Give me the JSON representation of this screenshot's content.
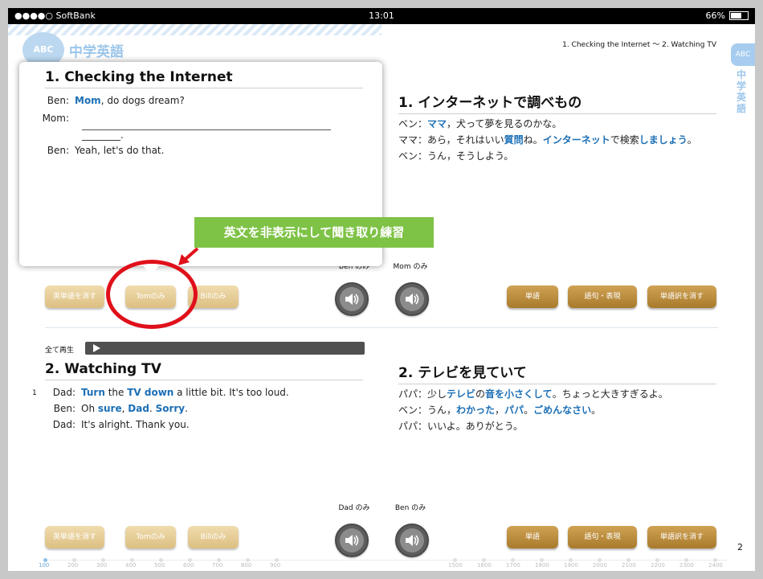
{
  "status_bar": {
    "carrier": "●●●●○ SoftBank",
    "time": "13:01",
    "battery": "66%"
  },
  "header": {
    "app_title": "中学英語",
    "logo_text": "ABC",
    "breadcrumb": "1. Checking the Internet ～ 2. Watching TV",
    "side_tab_text": "中学英語"
  },
  "section1": {
    "en_title": "1. Checking the Internet",
    "en_lines": [
      {
        "speaker": "Ben:",
        "parts": [
          {
            "t": "Mom",
            "h": true
          },
          {
            "t": ", do dogs dream?",
            "h": false
          }
        ]
      },
      {
        "speaker": "Mom:",
        "parts": []
      },
      {
        "speaker": "Ben:",
        "parts": [
          {
            "t": "Yeah, let's do that.",
            "h": false
          }
        ]
      }
    ],
    "blank_end": "________.",
    "jp_title": "1. インターネットで調べもの",
    "jp_lines": [
      [
        {
          "t": "ベン：",
          "h": false
        },
        {
          "t": "ママ",
          "h": true
        },
        {
          "t": "，犬って夢を見るのかな。",
          "h": false
        }
      ],
      [
        {
          "t": "ママ：あら，それはいい",
          "h": false
        },
        {
          "t": "質問",
          "h": true
        },
        {
          "t": "ね。",
          "h": false
        },
        {
          "t": "インターネット",
          "h": true
        },
        {
          "t": "で検索",
          "h": false
        },
        {
          "t": "しましょう",
          "h": true
        },
        {
          "t": "。",
          "h": false
        }
      ],
      [
        {
          "t": "ベン：うん，そうしよう。",
          "h": false
        }
      ]
    ],
    "buttons_left": [
      "英単語を消す",
      "Tomのみ",
      "Billのみ"
    ],
    "buttons_right": [
      "単語",
      "語句・表現",
      "単語訳を消す"
    ],
    "speakers": [
      "Ben のみ",
      "Mom のみ"
    ]
  },
  "popup_tip": "英文を非表示にして聞き取り練習",
  "play_all_label": "全て再生",
  "section2": {
    "row_number": "1",
    "en_title": "2. Watching TV",
    "en_lines": [
      {
        "speaker": "Dad:",
        "parts": [
          {
            "t": "Turn",
            "h": true
          },
          {
            "t": " the ",
            "h": false
          },
          {
            "t": "TV down",
            "h": true
          },
          {
            "t": " a little bit.  It's too loud.",
            "h": false
          }
        ]
      },
      {
        "speaker": "Ben:",
        "parts": [
          {
            "t": "Oh ",
            "h": false
          },
          {
            "t": "sure",
            "h": true
          },
          {
            "t": ", ",
            "h": false
          },
          {
            "t": "Dad",
            "h": true
          },
          {
            "t": ".  ",
            "h": false
          },
          {
            "t": "Sorry",
            "h": true
          },
          {
            "t": ".",
            "h": false
          }
        ]
      },
      {
        "speaker": "Dad:",
        "parts": [
          {
            "t": "It's alright.  Thank you.",
            "h": false
          }
        ]
      }
    ],
    "jp_title": "2. テレビを見ていて",
    "jp_lines": [
      [
        {
          "t": "パパ：少し",
          "h": false
        },
        {
          "t": "テレビ",
          "h": true
        },
        {
          "t": "の",
          "h": false
        },
        {
          "t": "音を小さくして",
          "h": true
        },
        {
          "t": "。ちょっと大きすぎるよ。",
          "h": false
        }
      ],
      [
        {
          "t": "ベン：うん，",
          "h": false
        },
        {
          "t": "わかった",
          "h": true
        },
        {
          "t": "，",
          "h": false
        },
        {
          "t": "パパ",
          "h": true
        },
        {
          "t": "。",
          "h": false
        },
        {
          "t": "ごめんなさい",
          "h": true
        },
        {
          "t": "。",
          "h": false
        }
      ],
      [
        {
          "t": "パパ：いいよ。ありがとう。",
          "h": false
        }
      ]
    ],
    "buttons_left": [
      "英単語を消す",
      "Tomのみ",
      "Billのみ"
    ],
    "buttons_right": [
      "単語",
      "語句・表現",
      "単語訳を消す"
    ],
    "speakers": [
      "Dad のみ",
      "Ben のみ"
    ]
  },
  "page_number": "2",
  "ruler_labels": [
    "100",
    "200",
    "300",
    "400",
    "500",
    "600",
    "700",
    "800",
    "900",
    "1500",
    "1600",
    "1700",
    "1800",
    "1900",
    "2000",
    "2100",
    "2200",
    "2300",
    "2400"
  ],
  "colors": {
    "highlight": "#1c6fb5",
    "tip_bg": "#7ec246",
    "annotation": "#e0101b",
    "button_gold": "#a97a2c",
    "button_tan": "#dcbf82"
  }
}
